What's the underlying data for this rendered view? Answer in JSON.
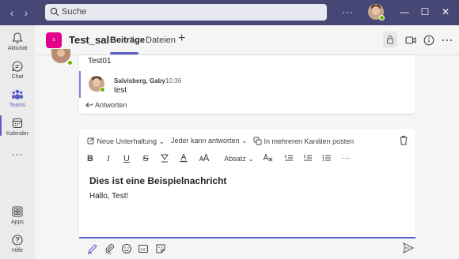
{
  "titlebar": {
    "search_placeholder": "Suche",
    "back_label": "‹",
    "forward_label": "›",
    "more_label": "···",
    "minimize_label": "—",
    "maximize_label": "☐",
    "close_label": "✕"
  },
  "rail": {
    "items": [
      {
        "label": "Aktivität",
        "icon": "bell-icon"
      },
      {
        "label": "Chat",
        "icon": "chat-icon"
      },
      {
        "label": "Teams",
        "icon": "teams-icon"
      },
      {
        "label": "Kalender",
        "icon": "calendar-icon"
      },
      {
        "label": "Apps",
        "icon": "apps-icon"
      },
      {
        "label": "Hilfe",
        "icon": "help-icon"
      }
    ],
    "more_label": "···",
    "active": "Teams"
  },
  "header": {
    "team_badge": "s",
    "team_name": "Test_sal",
    "tabs": [
      {
        "label": "Beiträge"
      },
      {
        "label": "Dateien"
      }
    ],
    "add_tab_label": "+"
  },
  "thread": {
    "message_text": "Test01",
    "reply": {
      "author": "Salvisberg, Gaby",
      "time": "10:36",
      "text": "test"
    },
    "reply_button": "Antworten"
  },
  "composer": {
    "new_conversation": "Neue Unterhaltung",
    "reply_permission": "Jeder kann antworten",
    "multi_channel": "In mehreren Kanälen posten",
    "format": {
      "bold": "B",
      "italic": "I",
      "underline": "U",
      "strike": "S",
      "paragraph": "Absatz",
      "more": "···"
    },
    "title": "Dies ist eine Beispielnachricht",
    "body": "Hallo, Test!"
  },
  "colors": {
    "titlebar": "#464775",
    "accent": "#5b5fc7",
    "team_badge": "#e3008c",
    "presence": "#6bb700"
  }
}
